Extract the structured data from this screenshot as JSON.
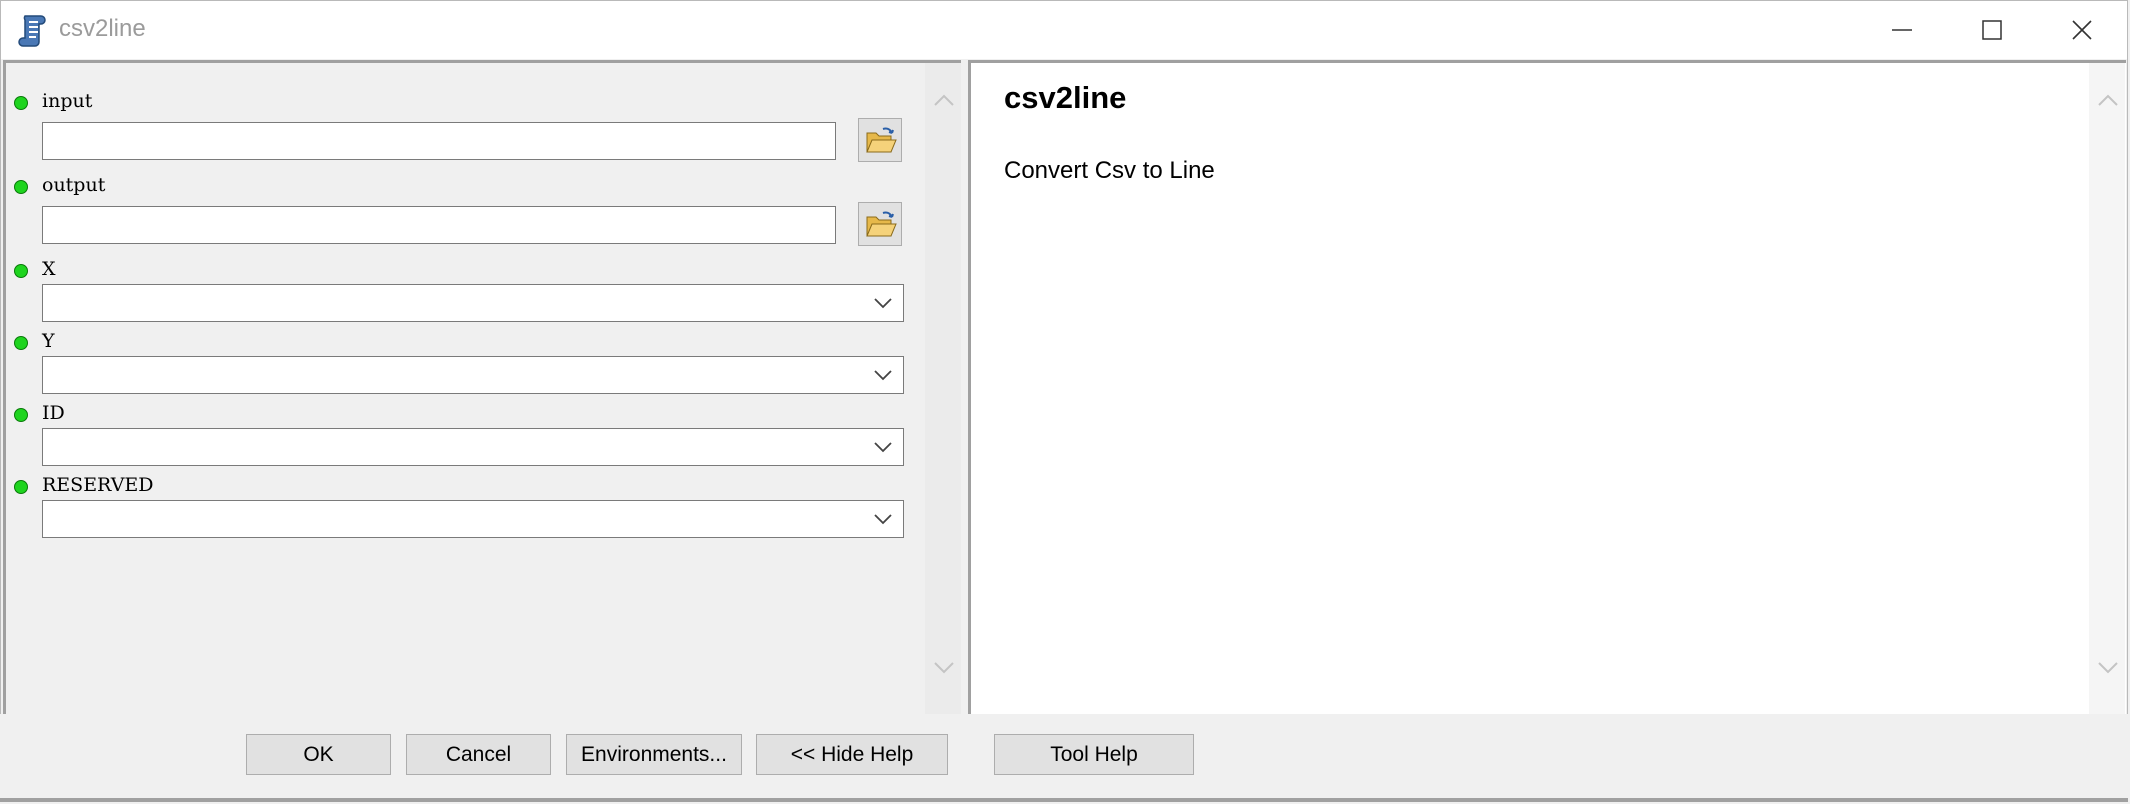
{
  "window": {
    "title": "csv2line"
  },
  "parameters": [
    {
      "label": "input",
      "control": "text-browse",
      "value": ""
    },
    {
      "label": "output",
      "control": "text-browse",
      "value": ""
    },
    {
      "label": "X",
      "control": "combo",
      "value": ""
    },
    {
      "label": "Y",
      "control": "combo",
      "value": ""
    },
    {
      "label": "ID",
      "control": "combo",
      "value": ""
    },
    {
      "label": "RESERVED",
      "control": "combo",
      "value": ""
    }
  ],
  "help": {
    "title": "csv2line",
    "description": "Convert Csv to Line"
  },
  "buttons": {
    "ok": "OK",
    "cancel": "Cancel",
    "environments": "Environments...",
    "hide_help": "<< Hide Help",
    "tool_help": "Tool Help"
  },
  "colors": {
    "required_dot": "#1fd41f",
    "window_bg": "#f0f0f0",
    "help_bg": "#ffffff"
  },
  "icons": {
    "app": "python-script-icon",
    "browse": "open-folder-icon",
    "combo": "chevron-down-icon"
  }
}
